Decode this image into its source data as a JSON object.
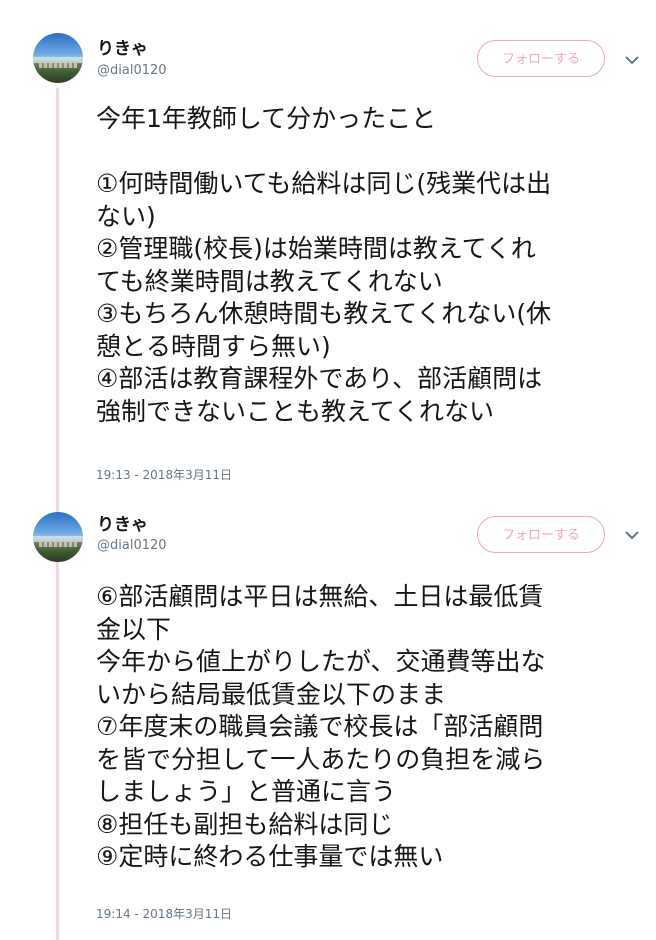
{
  "tweets": [
    {
      "author": {
        "name": "りきゃ",
        "handle": "@dial0120"
      },
      "follow_label": "フォローする",
      "text_lines": [
        "今年1年教師して分かったこと",
        "",
        "①何時間働いても給料は同じ(残業代は出",
        "ない)",
        "②管理職(校長)は始業時間は教えてくれ",
        "ても終業時間は教えてくれない",
        "③もちろん休憩時間も教えてくれない(休",
        "憩とる時間すら無い)",
        "④部活は教育課程外であり、部活顧問は",
        "強制できないことも教えてくれない"
      ],
      "timestamp": "19:13 - 2018年3月11日"
    },
    {
      "author": {
        "name": "りきゃ",
        "handle": "@dial0120"
      },
      "follow_label": "フォローする",
      "text_lines": [
        "⑥部活顧問は平日は無給、土日は最低賃",
        "金以下",
        "今年から値上がりしたが、交通費等出な",
        "いから結局最低賃金以下のまま",
        "⑦年度末の職員会議で校長は「部活顧問",
        "を皆で分担して一人あたりの負担を減ら",
        "しましょう」と普通に言う",
        "⑧担任も副担も給料は同じ",
        "⑨定時に終わる仕事量では無い"
      ],
      "timestamp": "19:14 - 2018年3月11日"
    }
  ],
  "icons": {
    "avatar": "avatar-image",
    "caret": "chevron-down-icon"
  },
  "colors": {
    "follow_accent": "#f2a6bd",
    "thread_line": "#f3d7e0",
    "secondary_text": "#657786",
    "primary_text": "#14171a"
  }
}
